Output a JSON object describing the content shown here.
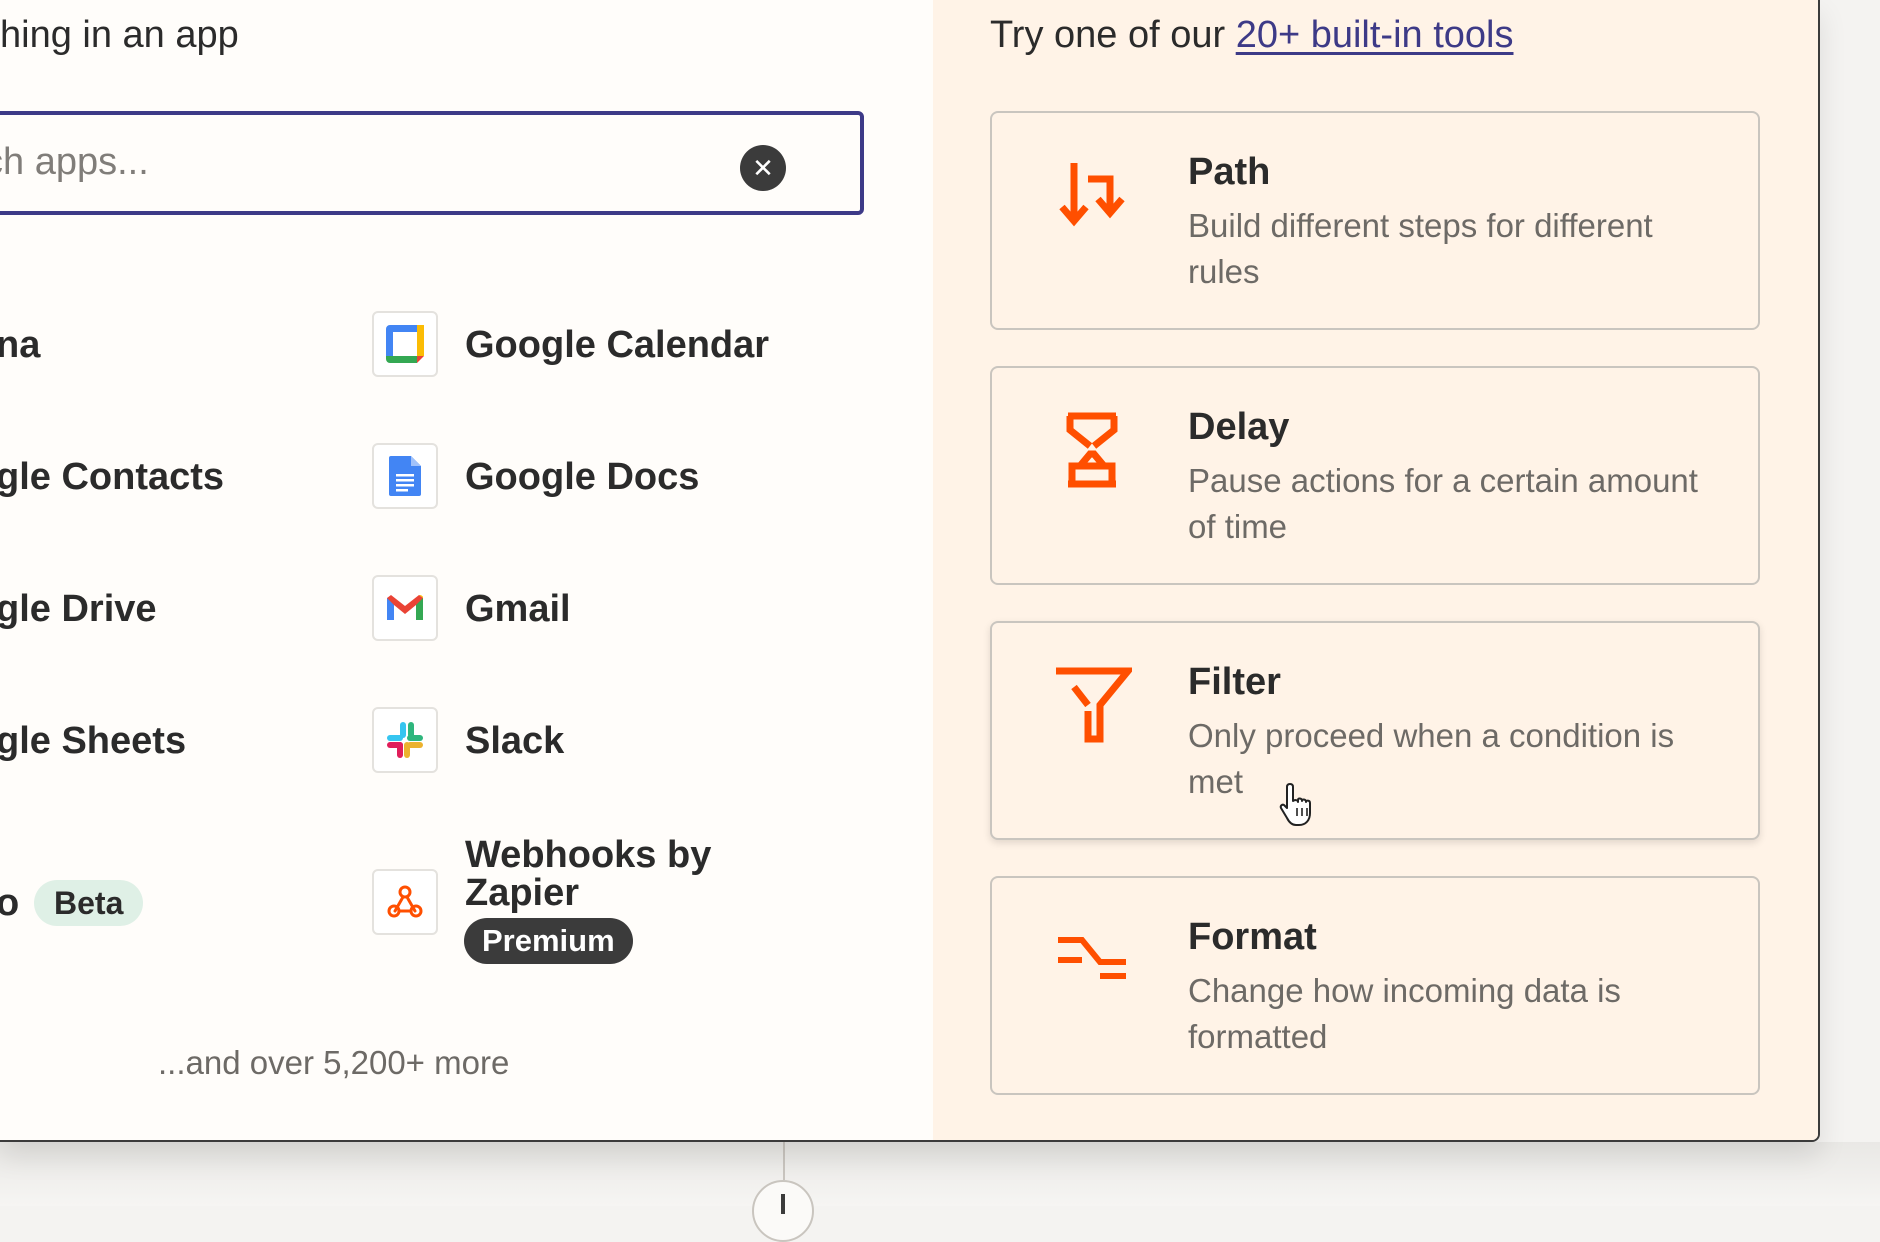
{
  "left_panel": {
    "heading": "hing in an app",
    "search": {
      "value": "ch apps..."
    },
    "apps_left": [
      {
        "label": "na"
      },
      {
        "label": "gle Contacts"
      },
      {
        "label": "gle Drive"
      },
      {
        "label": "gle Sheets"
      },
      {
        "label": "o",
        "badge": "Beta"
      }
    ],
    "apps_right": [
      {
        "label": "Google Calendar",
        "icon": "google-calendar-icon"
      },
      {
        "label": "Google Docs",
        "icon": "google-docs-icon"
      },
      {
        "label": "Gmail",
        "icon": "gmail-icon"
      },
      {
        "label": "Slack",
        "icon": "slack-icon"
      },
      {
        "label_line1": "Webhooks by",
        "label_line2": "Zapier",
        "badge": "Premium",
        "icon": "webhooks-icon"
      }
    ],
    "more_text": "...and over 5,200+ more"
  },
  "right_panel": {
    "intro_text": "Try one of our ",
    "intro_link": "20+ built-in tools",
    "tools": [
      {
        "title": "Path",
        "description": "Build different steps for different rules",
        "icon": "path-icon"
      },
      {
        "title": "Delay",
        "description": "Pause actions for a certain amount of time",
        "icon": "hourglass-icon"
      },
      {
        "title": "Filter",
        "description": "Only proceed when a condition is met",
        "icon": "filter-icon"
      },
      {
        "title": "Format",
        "description": "Change how incoming data is formatted",
        "icon": "format-icon"
      }
    ]
  },
  "colors": {
    "accent": "#3d3a87",
    "tool_icon": "#ff4f00",
    "right_panel_bg": "#fff3e7",
    "premium_badge": "#3b3b3b",
    "beta_badge": "#dff0e6"
  }
}
